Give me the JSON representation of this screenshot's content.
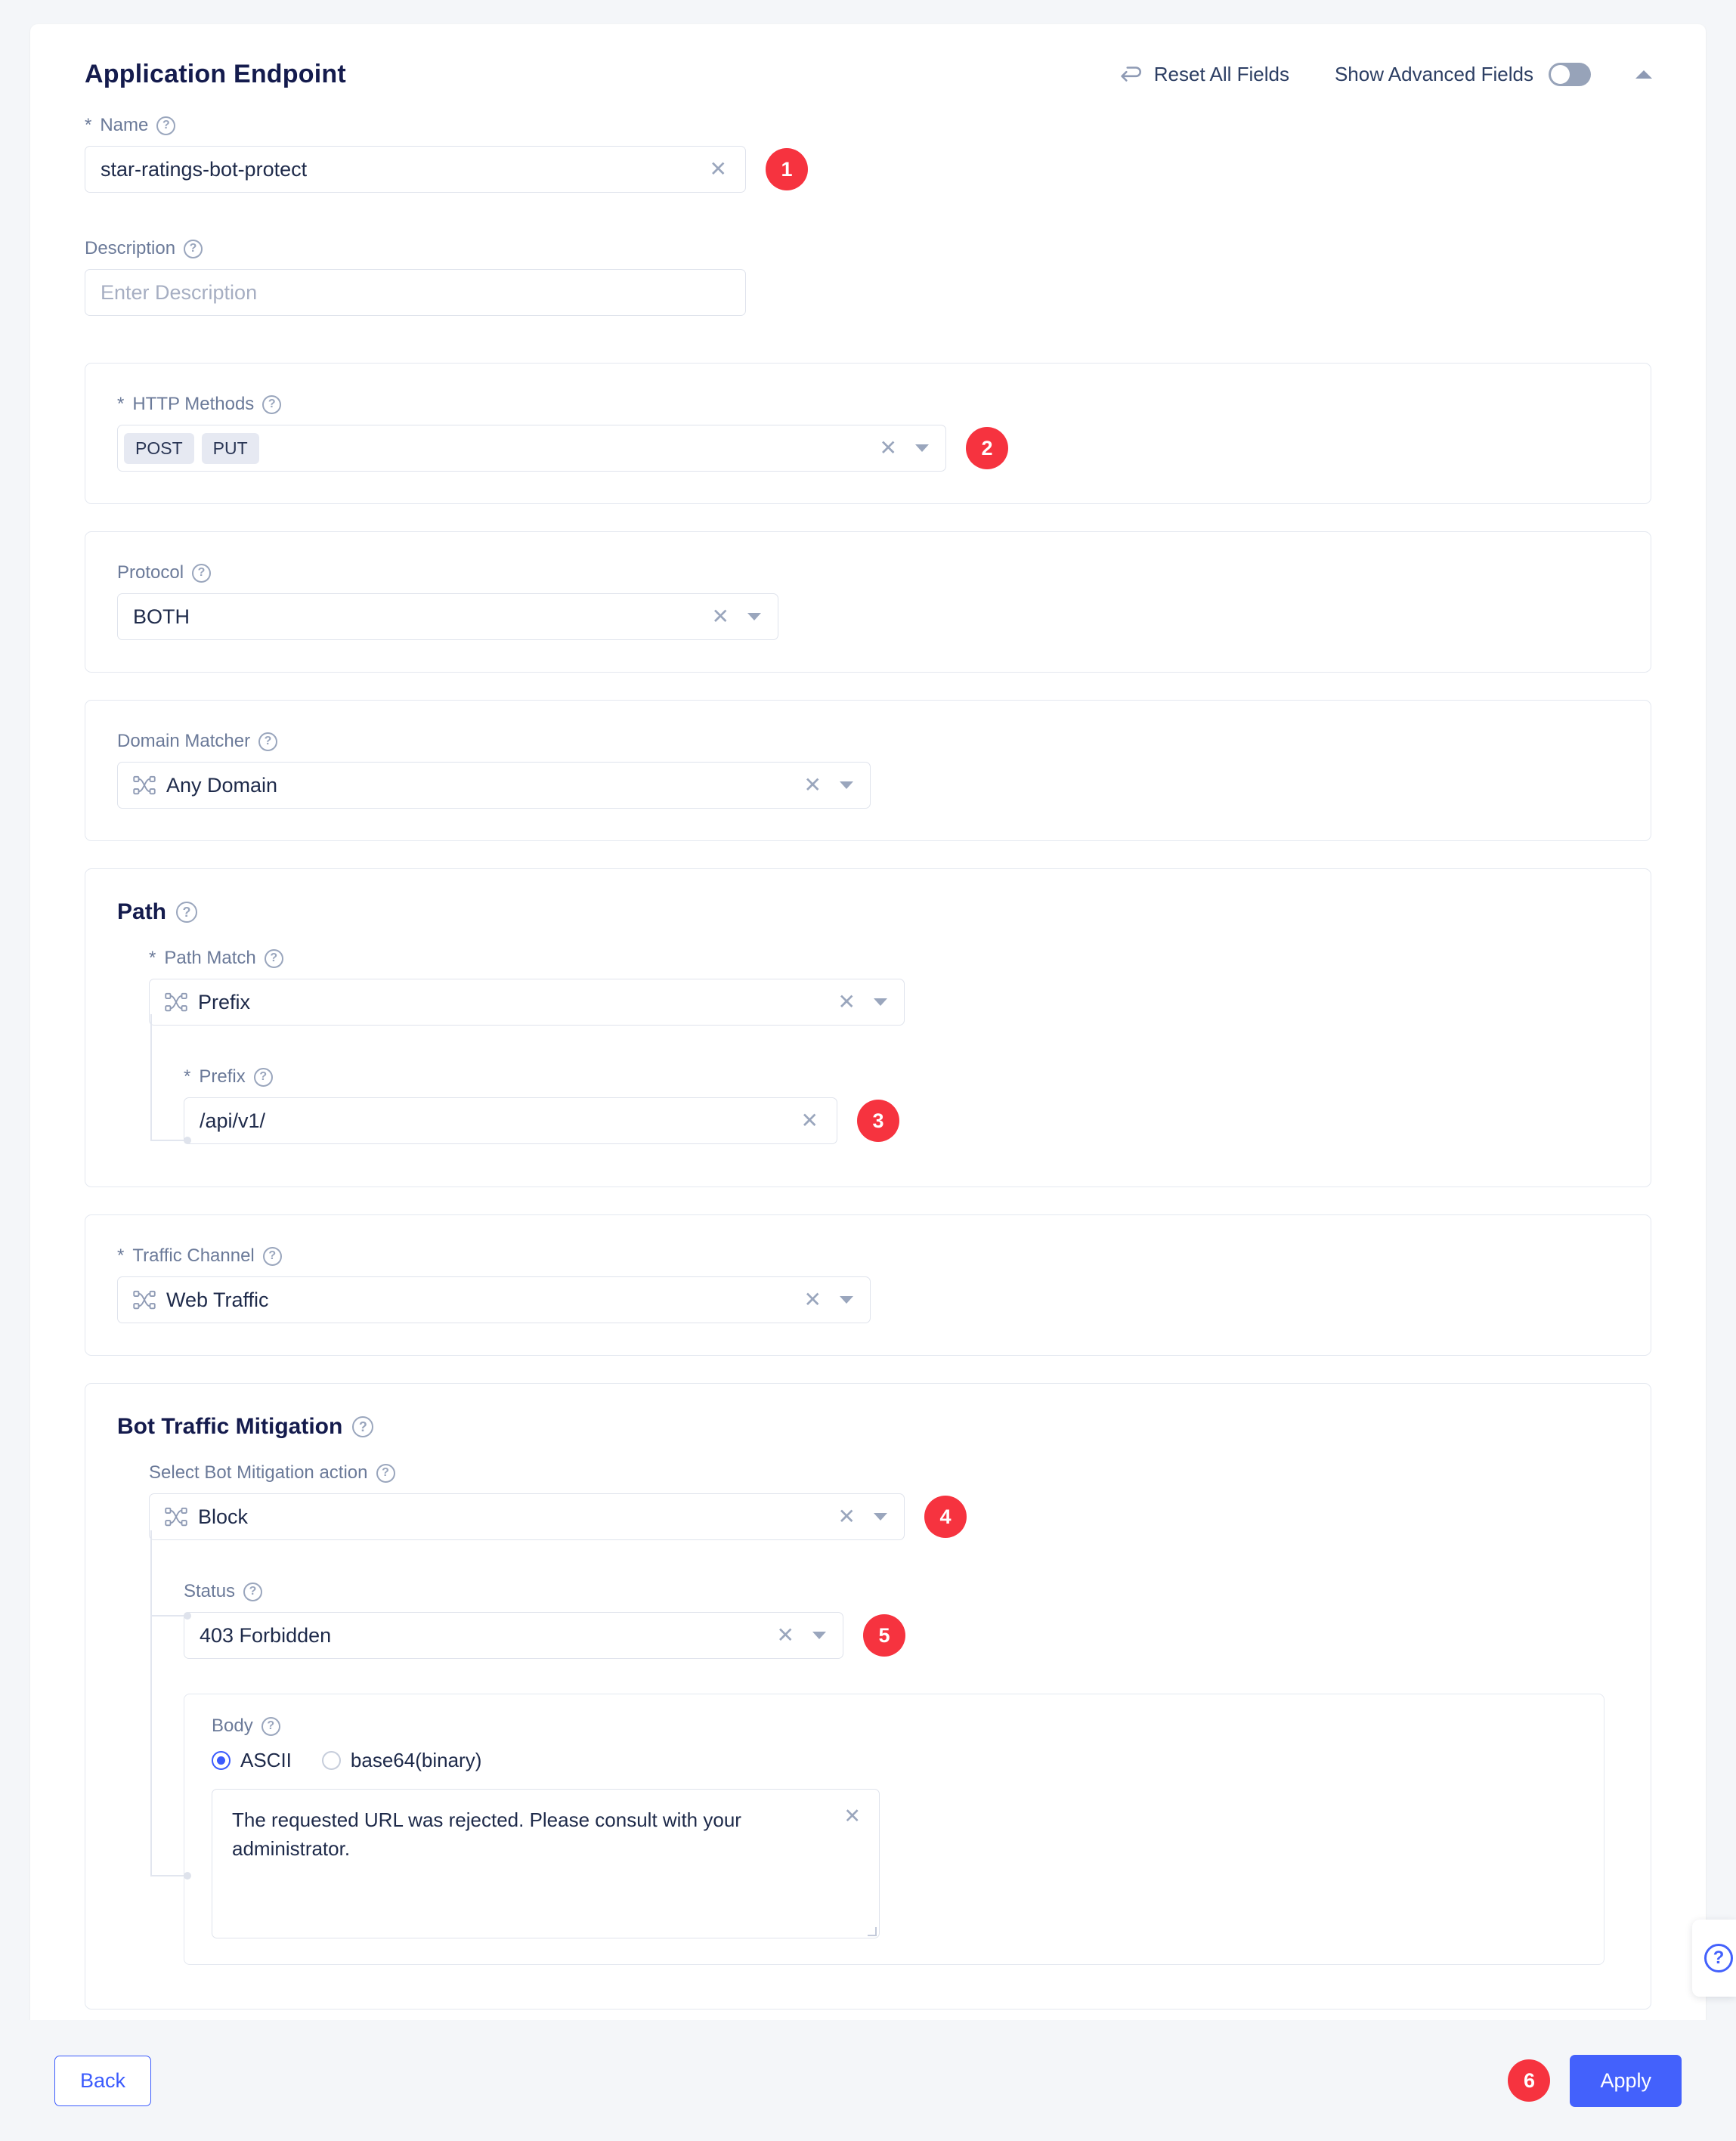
{
  "header": {
    "title": "Application Endpoint",
    "reset_label": "Reset All Fields",
    "advanced_label": "Show Advanced Fields",
    "advanced_on": false,
    "reset_icon": "undo-arrow-icon",
    "collapse_icon": "chevron-up-icon"
  },
  "fields": {
    "name": {
      "label": "Name",
      "required_mark": "*",
      "value": "star-ratings-bot-protect",
      "badge": "1"
    },
    "description": {
      "label": "Description",
      "value": "",
      "placeholder": "Enter Description"
    },
    "http_methods": {
      "label": "HTTP Methods",
      "required_mark": "*",
      "tags": [
        "POST",
        "PUT"
      ],
      "badge": "2"
    },
    "protocol": {
      "label": "Protocol",
      "value": "BOTH"
    },
    "domain_matcher": {
      "label": "Domain Matcher",
      "value": "Any Domain",
      "icon": "node-graph-icon"
    },
    "path_section": {
      "title": "Path",
      "path_match": {
        "label": "Path Match",
        "required_mark": "*",
        "value": "Prefix",
        "icon": "node-graph-icon"
      },
      "prefix": {
        "label": "Prefix",
        "required_mark": "*",
        "value": "/api/v1/",
        "badge": "3"
      }
    },
    "traffic_channel": {
      "label": "Traffic Channel",
      "required_mark": "*",
      "value": "Web Traffic",
      "icon": "node-graph-icon"
    },
    "bot_section": {
      "title": "Bot Traffic Mitigation",
      "action": {
        "label": "Select Bot Mitigation action",
        "value": "Block",
        "icon": "node-graph-icon",
        "badge": "4"
      },
      "status": {
        "label": "Status",
        "value": "403 Forbidden",
        "badge": "5"
      },
      "body": {
        "label": "Body",
        "encoding_options": [
          "ASCII",
          "base64(binary)"
        ],
        "encoding_selected": "ASCII",
        "text": "The requested URL was rejected. Please consult with your administrator."
      }
    }
  },
  "footer": {
    "back_label": "Back",
    "apply_label": "Apply",
    "apply_badge": "6"
  },
  "help_tab": {
    "icon": "question-mark-circle-icon",
    "glyph": "?"
  },
  "glyphs": {
    "clear_x": "✕",
    "question": "?"
  },
  "colors": {
    "page_bg": "#f4f6f9",
    "title": "#141b4d",
    "label": "#6b7a99",
    "badge_red": "#f6333f",
    "accent_blue": "#4361fc",
    "tag_bg": "#e6e9f2",
    "border": "#dfe3ec"
  }
}
